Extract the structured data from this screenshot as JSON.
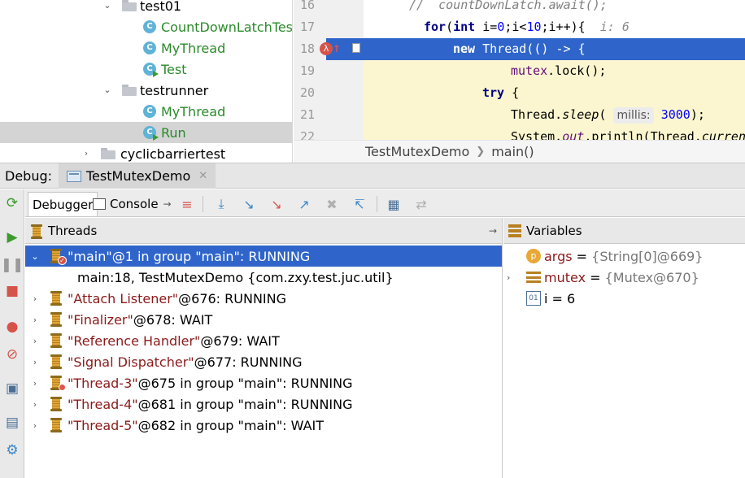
{
  "project_tree": {
    "items": [
      {
        "label": "test01",
        "kind": "package",
        "expanded": true
      },
      {
        "label": "CountDownLatchTest",
        "kind": "class"
      },
      {
        "label": "MyThread",
        "kind": "class"
      },
      {
        "label": "Test",
        "kind": "runnable-class"
      },
      {
        "label": "testrunner",
        "kind": "package",
        "expanded": true
      },
      {
        "label": "MyThread",
        "kind": "class"
      },
      {
        "label": "Run",
        "kind": "runnable-class",
        "selected": true
      },
      {
        "label": "cyclicbarriertest",
        "kind": "package",
        "expanded": false
      }
    ]
  },
  "editor": {
    "lines": [
      {
        "no": "16",
        "comment": "//  countDownLatch.await();"
      },
      {
        "no": "17",
        "kw1": "for",
        "p1": "(",
        "kw2": "int",
        "p2": " i=",
        "n1": "0",
        "p3": ";i<",
        "n2": "10",
        "p4": ";i++){  ",
        "hint": "i: 6"
      },
      {
        "no": "18",
        "kw1": "new",
        "p1": " Thread(() -> {"
      },
      {
        "no": "19",
        "field": "mutex",
        "p1": ".lock();"
      },
      {
        "no": "20",
        "kw1": "try",
        "p1": " {"
      },
      {
        "no": "21",
        "p1": "Thread.",
        "italic": "sleep",
        "p2": "( ",
        "hint_label": "millis:",
        "n1": "3000",
        "p3": ");"
      },
      {
        "no": "22",
        "p1": "System.",
        "field_italic": "out",
        "p2": ".println(Thread.",
        "italic": "curren"
      }
    ],
    "breadcrumb": [
      "TestMutexDemo",
      "main()"
    ]
  },
  "debug": {
    "title": "Debug:",
    "session_tab": "TestMutexDemo",
    "tabs": {
      "debugger": "Debugger",
      "console": "Console"
    },
    "threads_header": "Threads",
    "variables_header": "Variables",
    "threads": [
      {
        "q": "\"main\"",
        "rest": "@1 in group \"main\": RUNNING",
        "selected": true,
        "expanded": true
      },
      {
        "frame": "main:18, TestMutexDemo {com.zxy.test.juc.util}"
      },
      {
        "q": "\"Attach Listener\"",
        "rest": "@676: RUNNING"
      },
      {
        "q": "\"Finalizer\"",
        "rest": "@678: WAIT"
      },
      {
        "q": "\"Reference Handler\"",
        "rest": "@679: WAIT"
      },
      {
        "q": "\"Signal Dispatcher\"",
        "rest": "@677: RUNNING"
      },
      {
        "q": "\"Thread-3\"",
        "rest": "@675 in group \"main\": RUNNING",
        "badge": true
      },
      {
        "q": "\"Thread-4\"",
        "rest": "@681 in group \"main\": RUNNING"
      },
      {
        "q": "\"Thread-5\"",
        "rest": "@682 in group \"main\": WAIT"
      }
    ],
    "variables": [
      {
        "name": "args",
        "eq": " = ",
        "value": "{String[0]@669}",
        "icon": "p"
      },
      {
        "name": "mutex",
        "eq": " = ",
        "value": "{Mutex@670}",
        "icon": "field"
      },
      {
        "name": "i",
        "eq": " = ",
        "value": "6",
        "icon": "int"
      }
    ]
  },
  "colors": {
    "selection": "#2f65ca",
    "breakpoint": "#d6534a",
    "current_line_yellow": "#fbf6cf",
    "class_green": "#2a8a2a",
    "thread_name": "#8b1a1a"
  }
}
